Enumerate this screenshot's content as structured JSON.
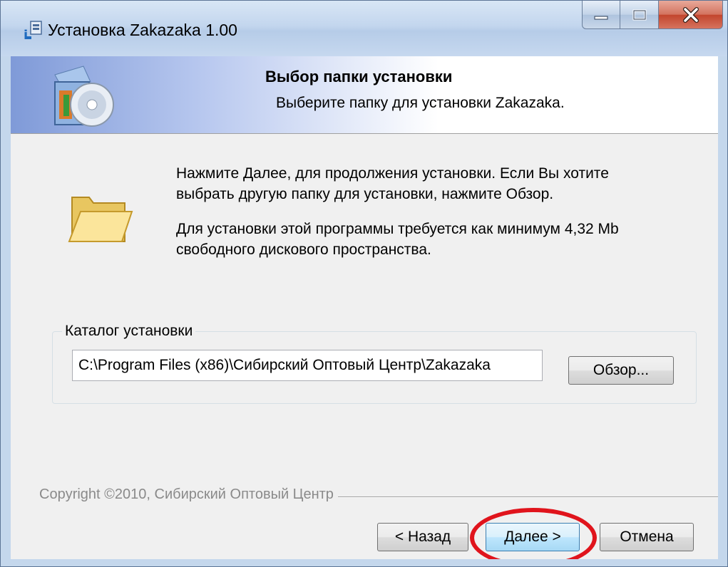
{
  "window": {
    "title": "Установка Zakazaka 1.00",
    "controls": {
      "minimize_icon": "minimize-icon",
      "maximize_icon": "maximize-icon",
      "close_icon": "close-icon"
    }
  },
  "header": {
    "title": "Выбор папки установки",
    "subtitle": "Выберите папку для установки Zakazaka."
  },
  "body": {
    "paragraph1_line1": "Нажмите Далее, для продолжения установки. Если Вы хотите",
    "paragraph1_line2": "выбрать другую папку для установки, нажмите Обзор.",
    "paragraph2_line1": "Для установки этой программы требуется как минимум 4,32 Mb",
    "paragraph2_line2": "свободного дискового пространства."
  },
  "install_dir": {
    "group_label": "Каталог установки",
    "path_value": "C:\\Program Files (x86)\\Сибирский Оптовый Центр\\Zakazaka",
    "browse_label": "Обзор..."
  },
  "footer": {
    "copyright": "Copyright ©2010, Сибирский Оптовый Центр",
    "back_label": "< Назад",
    "next_label": "Далее >",
    "cancel_label": "Отмена"
  },
  "colors": {
    "highlight_ellipse": "#e0141c",
    "header_gradient_start": "#7f9ad8"
  }
}
